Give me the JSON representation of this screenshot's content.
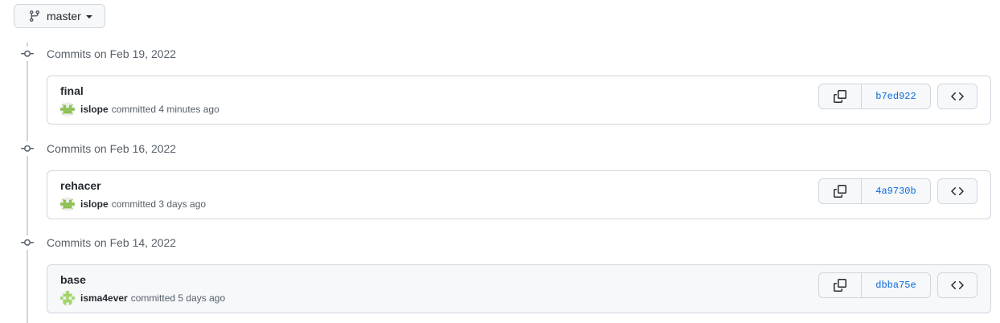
{
  "branch": {
    "name": "master",
    "icon": "git-branch-icon"
  },
  "groups": [
    {
      "title": "Commits on Feb 19, 2022",
      "commit": {
        "message": "final",
        "author": "islope",
        "time_text": "committed 4 minutes ago",
        "sha": "b7ed922",
        "avatar": "identicon-green"
      }
    },
    {
      "title": "Commits on Feb 16, 2022",
      "commit": {
        "message": "rehacer",
        "author": "islope",
        "time_text": "committed 3 days ago",
        "sha": "4a9730b",
        "avatar": "identicon-green"
      }
    },
    {
      "title": "Commits on Feb 14, 2022",
      "commit": {
        "message": "base",
        "author": "isma4ever",
        "time_text": "committed 5 days ago",
        "sha": "dbba75e",
        "avatar": "identicon-light-green"
      }
    }
  ],
  "colors": {
    "link": "#0969da",
    "border": "#d0d7de",
    "muted": "#57606a",
    "button_bg": "#f6f8fa"
  }
}
